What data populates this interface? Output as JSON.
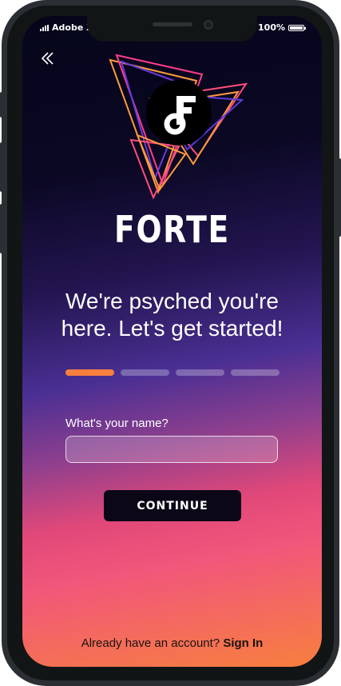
{
  "status_bar": {
    "carrier": "Adobe X",
    "battery": "100%"
  },
  "icons": {
    "back": "chevron-double-left-icon",
    "logo": "forte-music-note-logo",
    "logo_letter": "F"
  },
  "brand": {
    "name": "FORTE"
  },
  "headline": {
    "line1": "We're psyched you're",
    "line2": "here. Let's get started!"
  },
  "progress": {
    "total_steps": 4,
    "current_step": 1
  },
  "form": {
    "name_label": "What's your name?",
    "name_value": "",
    "name_placeholder": ""
  },
  "actions": {
    "continue_label": "CONTINUE"
  },
  "footer": {
    "prompt": "Already have an account?",
    "link": "Sign In"
  },
  "colors": {
    "accent_orange": "#f7803e",
    "logo_pink": "#ff3d8a",
    "logo_purple": "#5b3bd6",
    "button_dark": "#0b0717"
  }
}
